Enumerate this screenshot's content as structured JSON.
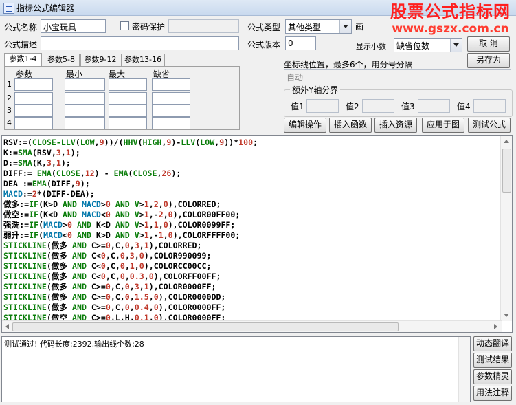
{
  "window": {
    "title": "指标公式编辑器"
  },
  "watermark": {
    "line1": "股票公式指标网",
    "line2": "www.gszx.com.cn"
  },
  "form": {
    "name_label": "公式名称",
    "name_value": "小宝玩具",
    "password_label": "密码保护",
    "type_label": "公式类型",
    "type_value": "其他类型",
    "type_extra_char": "画",
    "desc_label": "公式描述",
    "version_label": "公式版本",
    "version_value": "0",
    "display_label": "显示小数",
    "display_value": "缺省位数"
  },
  "buttons": {
    "cancel": "取 消",
    "save_as": "另存为",
    "edit_ops": "编辑操作",
    "insert_func": "插入函数",
    "insert_res": "插入资源",
    "apply_chart": "应用于图",
    "test_formula": "测试公式",
    "dyn_translate": "动态翻译",
    "test_result": "测试结果",
    "param_tune": "参数精灵",
    "usage_note": "用法注释"
  },
  "tabs": [
    "参数1-4",
    "参数5-8",
    "参数9-12",
    "参数13-16"
  ],
  "params": {
    "headers": [
      "参数",
      "最小",
      "最大",
      "缺省"
    ],
    "rows": [
      "1",
      "2",
      "3",
      "4"
    ]
  },
  "axis": {
    "label": "坐标线位置，最多6个，用分号分隔",
    "value": "自动"
  },
  "ybound": {
    "title": "额外Y轴分界",
    "labels": [
      "值1",
      "值2",
      "值3",
      "值4"
    ]
  },
  "code_lines": [
    [
      [
        "k",
        "RSV:=("
      ],
      [
        "f",
        "CLOSE-LLV"
      ],
      [
        "k",
        "("
      ],
      [
        "f",
        "LOW"
      ],
      [
        "k",
        ","
      ],
      [
        "n",
        "9"
      ],
      [
        "k",
        "))/("
      ],
      [
        "f",
        "HHV"
      ],
      [
        "k",
        "("
      ],
      [
        "f",
        "HIGH"
      ],
      [
        "k",
        ","
      ],
      [
        "n",
        "9"
      ],
      [
        "k",
        ")-"
      ],
      [
        "f",
        "LLV"
      ],
      [
        "k",
        "("
      ],
      [
        "f",
        "LOW"
      ],
      [
        "k",
        ","
      ],
      [
        "n",
        "9"
      ],
      [
        "k",
        "))*"
      ],
      [
        "n",
        "100"
      ],
      [
        "k",
        ";"
      ]
    ],
    [
      [
        "k",
        "K:="
      ],
      [
        "f",
        "SMA"
      ],
      [
        "k",
        "(RSV,"
      ],
      [
        "n",
        "3"
      ],
      [
        "k",
        ","
      ],
      [
        "n",
        "1"
      ],
      [
        "k",
        ");"
      ]
    ],
    [
      [
        "k",
        "D:="
      ],
      [
        "f",
        "SMA"
      ],
      [
        "k",
        "(K,"
      ],
      [
        "n",
        "3"
      ],
      [
        "k",
        ","
      ],
      [
        "n",
        "1"
      ],
      [
        "k",
        ");"
      ]
    ],
    [
      [
        "k",
        "DIFF:= "
      ],
      [
        "f",
        "EMA"
      ],
      [
        "k",
        "("
      ],
      [
        "f",
        "CLOSE"
      ],
      [
        "k",
        ","
      ],
      [
        "n",
        "12"
      ],
      [
        "k",
        ") - "
      ],
      [
        "f",
        "EMA"
      ],
      [
        "k",
        "("
      ],
      [
        "f",
        "CLOSE"
      ],
      [
        "k",
        ","
      ],
      [
        "n",
        "26"
      ],
      [
        "k",
        ");"
      ]
    ],
    [
      [
        "k",
        "DEA :="
      ],
      [
        "f",
        "EMA"
      ],
      [
        "k",
        "(DIFF,"
      ],
      [
        "n",
        "9"
      ],
      [
        "k",
        ");"
      ]
    ],
    [
      [
        "v",
        "MACD"
      ],
      [
        "k",
        ":="
      ],
      [
        "n",
        "2"
      ],
      [
        "k",
        "*(DIFF-DEA);"
      ]
    ],
    [
      [
        "k",
        "做多:="
      ],
      [
        "f",
        "IF"
      ],
      [
        "k",
        "(K>D "
      ],
      [
        "o",
        "AND"
      ],
      [
        "k",
        " "
      ],
      [
        "v",
        "MACD"
      ],
      [
        "k",
        ">"
      ],
      [
        "n",
        "0"
      ],
      [
        "k",
        " "
      ],
      [
        "o",
        "AND"
      ],
      [
        "k",
        " "
      ],
      [
        "f",
        "V"
      ],
      [
        "k",
        ">"
      ],
      [
        "n",
        "1"
      ],
      [
        "k",
        ","
      ],
      [
        "n",
        "2"
      ],
      [
        "k",
        ","
      ],
      [
        "n",
        "0"
      ],
      [
        "k",
        "),COLORRED;"
      ]
    ],
    [
      [
        "k",
        "做空:="
      ],
      [
        "f",
        "IF"
      ],
      [
        "k",
        "(K<D "
      ],
      [
        "o",
        "AND"
      ],
      [
        "k",
        " "
      ],
      [
        "v",
        "MACD"
      ],
      [
        "k",
        "<"
      ],
      [
        "n",
        "0"
      ],
      [
        "k",
        " "
      ],
      [
        "o",
        "AND"
      ],
      [
        "k",
        " "
      ],
      [
        "f",
        "V"
      ],
      [
        "k",
        ">"
      ],
      [
        "n",
        "1"
      ],
      [
        "k",
        ",-"
      ],
      [
        "n",
        "2"
      ],
      [
        "k",
        ","
      ],
      [
        "n",
        "0"
      ],
      [
        "k",
        "),COLOR00FF00;"
      ]
    ],
    [
      [
        "k",
        "强洗:="
      ],
      [
        "f",
        "IF"
      ],
      [
        "k",
        "("
      ],
      [
        "v",
        "MACD"
      ],
      [
        "k",
        ">"
      ],
      [
        "n",
        "0"
      ],
      [
        "k",
        " "
      ],
      [
        "o",
        "AND"
      ],
      [
        "k",
        " K<D "
      ],
      [
        "o",
        "AND"
      ],
      [
        "k",
        " "
      ],
      [
        "f",
        "V"
      ],
      [
        "k",
        ">"
      ],
      [
        "n",
        "1"
      ],
      [
        "k",
        ","
      ],
      [
        "n",
        "1"
      ],
      [
        "k",
        ","
      ],
      [
        "n",
        "0"
      ],
      [
        "k",
        "),COLOR0099FF;"
      ]
    ],
    [
      [
        "k",
        "弱升:="
      ],
      [
        "f",
        "IF"
      ],
      [
        "k",
        "("
      ],
      [
        "v",
        "MACD"
      ],
      [
        "k",
        "<"
      ],
      [
        "n",
        "0"
      ],
      [
        "k",
        " "
      ],
      [
        "o",
        "AND"
      ],
      [
        "k",
        " K>D "
      ],
      [
        "o",
        "AND"
      ],
      [
        "k",
        " "
      ],
      [
        "f",
        "V"
      ],
      [
        "k",
        ">"
      ],
      [
        "n",
        "1"
      ],
      [
        "k",
        ",-"
      ],
      [
        "n",
        "1"
      ],
      [
        "k",
        ","
      ],
      [
        "n",
        "0"
      ],
      [
        "k",
        "),COLORFFFF00;"
      ]
    ],
    [
      [
        "f",
        "STICKLINE"
      ],
      [
        "k",
        "(做多 "
      ],
      [
        "o",
        "AND"
      ],
      [
        "k",
        " C>="
      ],
      [
        "n",
        "0"
      ],
      [
        "k",
        ",C,"
      ],
      [
        "n",
        "0"
      ],
      [
        "k",
        ","
      ],
      [
        "n",
        "3"
      ],
      [
        "k",
        ","
      ],
      [
        "n",
        "1"
      ],
      [
        "k",
        "),COLORRED;"
      ]
    ],
    [
      [
        "f",
        "STICKLINE"
      ],
      [
        "k",
        "(做多 "
      ],
      [
        "o",
        "AND"
      ],
      [
        "k",
        " C<"
      ],
      [
        "n",
        "0"
      ],
      [
        "k",
        ",C,"
      ],
      [
        "n",
        "0"
      ],
      [
        "k",
        ","
      ],
      [
        "n",
        "3"
      ],
      [
        "k",
        ","
      ],
      [
        "n",
        "0"
      ],
      [
        "k",
        "),COLOR990099;"
      ]
    ],
    [
      [
        "f",
        "STICKLINE"
      ],
      [
        "k",
        "(做多 "
      ],
      [
        "o",
        "AND"
      ],
      [
        "k",
        " C<"
      ],
      [
        "n",
        "0"
      ],
      [
        "k",
        ",C,"
      ],
      [
        "n",
        "0"
      ],
      [
        "k",
        ","
      ],
      [
        "n",
        "1"
      ],
      [
        "k",
        ","
      ],
      [
        "n",
        "0"
      ],
      [
        "k",
        "),COLORCC00CC;"
      ]
    ],
    [
      [
        "f",
        "STICKLINE"
      ],
      [
        "k",
        "(做多 "
      ],
      [
        "o",
        "AND"
      ],
      [
        "k",
        " C<"
      ],
      [
        "n",
        "0"
      ],
      [
        "k",
        ",C,"
      ],
      [
        "n",
        "0"
      ],
      [
        "k",
        ","
      ],
      [
        "n",
        "0.3"
      ],
      [
        "k",
        ","
      ],
      [
        "n",
        "0"
      ],
      [
        "k",
        "),COLORFF00FF;"
      ]
    ],
    [
      [
        "f",
        "STICKLINE"
      ],
      [
        "k",
        "(做多 "
      ],
      [
        "o",
        "AND"
      ],
      [
        "k",
        " C>="
      ],
      [
        "n",
        "0"
      ],
      [
        "k",
        ",C,"
      ],
      [
        "n",
        "0"
      ],
      [
        "k",
        ","
      ],
      [
        "n",
        "3"
      ],
      [
        "k",
        ","
      ],
      [
        "n",
        "1"
      ],
      [
        "k",
        "),COLOR0000FF;"
      ]
    ],
    [
      [
        "f",
        "STICKLINE"
      ],
      [
        "k",
        "(做多 "
      ],
      [
        "o",
        "AND"
      ],
      [
        "k",
        " C>="
      ],
      [
        "n",
        "0"
      ],
      [
        "k",
        ",C,"
      ],
      [
        "n",
        "0"
      ],
      [
        "k",
        ","
      ],
      [
        "n",
        "1.5"
      ],
      [
        "k",
        ","
      ],
      [
        "n",
        "0"
      ],
      [
        "k",
        "),COLOR0000DD;"
      ]
    ],
    [
      [
        "f",
        "STICKLINE"
      ],
      [
        "k",
        "(做多 "
      ],
      [
        "o",
        "AND"
      ],
      [
        "k",
        " C>="
      ],
      [
        "n",
        "0"
      ],
      [
        "k",
        ",C,"
      ],
      [
        "n",
        "0"
      ],
      [
        "k",
        ","
      ],
      [
        "n",
        "0.4"
      ],
      [
        "k",
        ","
      ],
      [
        "n",
        "0"
      ],
      [
        "k",
        "),COLOR0000FF;"
      ]
    ],
    [
      [
        "f",
        "STICKLINE"
      ],
      [
        "k",
        "(做空 "
      ],
      [
        "o",
        "AND"
      ],
      [
        "k",
        " C>="
      ],
      [
        "n",
        "0"
      ],
      [
        "k",
        ",L,H,"
      ],
      [
        "n",
        "0.1"
      ],
      [
        "k",
        ","
      ],
      [
        "n",
        "0"
      ],
      [
        "k",
        "),COLOR0000FF;"
      ]
    ]
  ],
  "status": {
    "text": "测试通过! 代码长度:2392,输出线个数:28"
  },
  "colors": {
    "keyword": "#000000",
    "function": "#0a7d0a",
    "number": "#c0392b",
    "variable": "#0077aa"
  }
}
